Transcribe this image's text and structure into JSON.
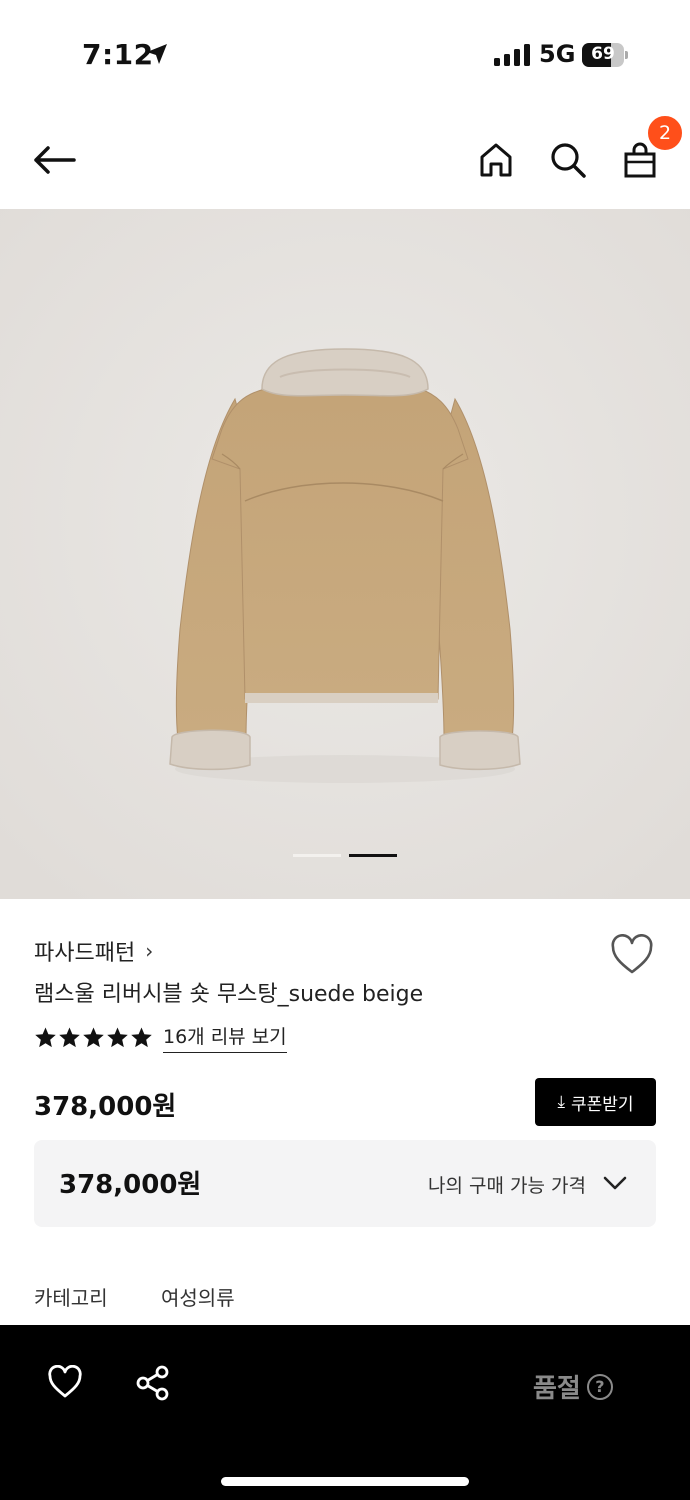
{
  "status_bar": {
    "time": "7:12",
    "network": "5G",
    "battery": "69",
    "battery_fraction": 0.69
  },
  "nav": {
    "cart_count": "2"
  },
  "gallery": {
    "image_count": 2,
    "active_index": 1
  },
  "product": {
    "brand": "파사드패턴",
    "brand_chevron": "›",
    "name": "램스울 리버시블 숏 무스탕_suede beige",
    "rating_stars": 5,
    "review_link": "16개 리뷰 보기",
    "price": "378,000원",
    "coupon_label": "쿠폰받기",
    "coupon_icon": "⤓",
    "my_price": "378,000원",
    "my_price_label": "나의 구매 가능 가격",
    "category_label": "카테고리",
    "category_value": "여성의류"
  },
  "bottom_bar": {
    "status": "품절",
    "help": "?"
  },
  "colors": {
    "accent": "#ff4f1a",
    "price_box_bg": "#f4f4f5",
    "bottom_bar_bg": "#000000",
    "soldout_text": "#8a8a8a",
    "coat_tan": "#c6a77b",
    "shearling": "#d8cfc4"
  },
  "icons": {
    "back": "arrow-left-icon",
    "home": "home-icon",
    "search": "search-icon",
    "cart": "shopping-bag-icon",
    "wishlist": "heart-icon",
    "share": "share-icon",
    "help": "help-circle-icon",
    "chevron": "chevron-down-icon"
  }
}
